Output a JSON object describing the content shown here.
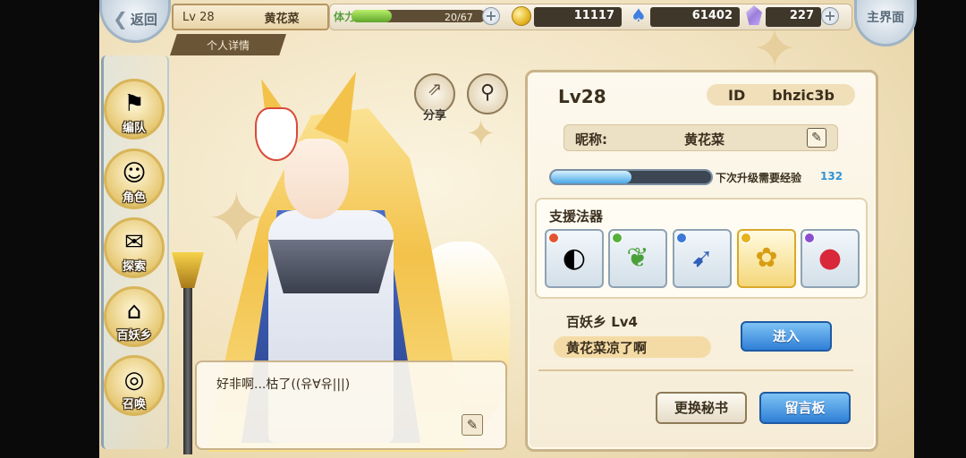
{
  "header": {
    "back_label": "返回",
    "home_label": "主界面",
    "level": "Lv 28",
    "name": "黄花菜",
    "detail_tab": "个人详情"
  },
  "resources": {
    "stamina_label": "体力",
    "stamina_text": "20/67",
    "stamina_fraction": 0.2985,
    "coins": "11117",
    "spirit": "61402",
    "gems": "227"
  },
  "nav": {
    "items": [
      {
        "label": "编队",
        "icon": "team-icon"
      },
      {
        "label": "角色",
        "icon": "character-icon"
      },
      {
        "label": "探索",
        "icon": "explore-icon"
      },
      {
        "label": "百妖乡",
        "icon": "village-icon"
      },
      {
        "label": "召唤",
        "icon": "summon-icon"
      }
    ]
  },
  "actions": {
    "share_label": "分享"
  },
  "dialog": {
    "text": "好非啊...枯了((유∀유|||)"
  },
  "profile": {
    "level": "Lv28",
    "id_label": "ID",
    "id_value": "bhzic3b",
    "nickname_label": "昵称:",
    "nickname_value": "黄花菜",
    "xp_label": "下次升级需要经验",
    "xp_needed": "132",
    "xp_fraction": 0.5,
    "support_title": "支援法器",
    "artifacts": [
      {
        "name": "artifact-1",
        "icon": "mirror-icon",
        "dot_color": "#e2562f"
      },
      {
        "name": "artifact-2",
        "icon": "leaf-fan-icon",
        "dot_color": "#55b03a"
      },
      {
        "name": "artifact-3",
        "icon": "bow-icon",
        "dot_color": "#3b78d8"
      },
      {
        "name": "artifact-4",
        "icon": "flower-icon",
        "dot_color": "#e6b21e"
      },
      {
        "name": "artifact-5",
        "icon": "daruma-icon",
        "dot_color": "#8a4fd0"
      }
    ],
    "village_name": "百妖乡  Lv4",
    "village_message": "黄花菜凉了啊",
    "enter_label": "进入",
    "change_secretary_label": "更换秘书",
    "message_board_label": "留言板"
  },
  "colors": {
    "accent_blue": "#2f7fd6",
    "panel_bg": "#fdf9ee",
    "gold": "#d9a82a",
    "stamina_green": "#5ea52b"
  }
}
